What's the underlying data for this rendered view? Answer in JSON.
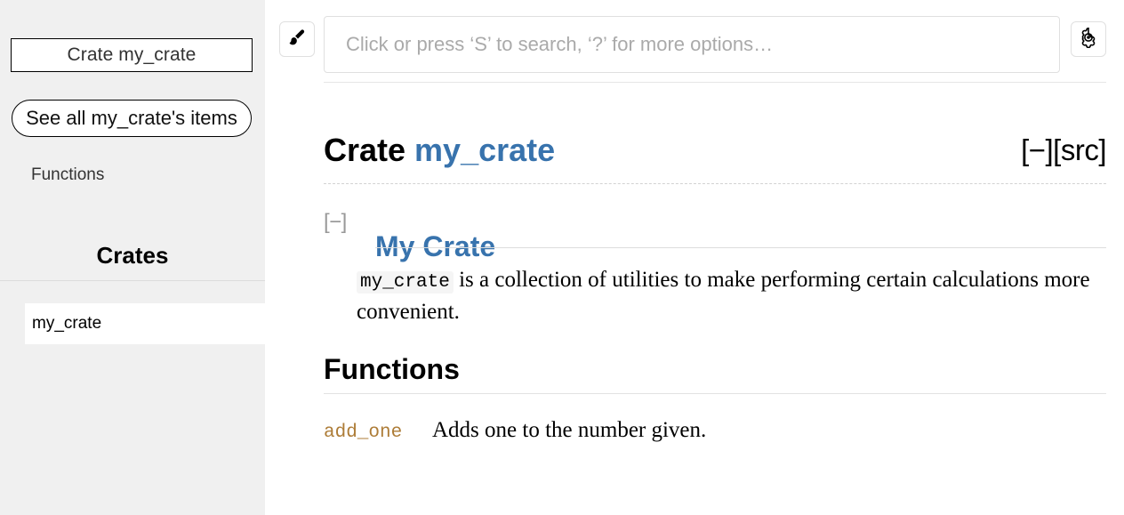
{
  "sidebar": {
    "crate_box_label": "Crate my_crate",
    "all_items_label": "See all my_crate's items",
    "section_link": "Functions",
    "crates_heading": "Crates",
    "crates": [
      {
        "name": "my_crate"
      }
    ]
  },
  "topbar": {
    "theme_icon": "paintbrush-icon",
    "settings_icon": "gear-icon",
    "search": {
      "value": "",
      "placeholder": "Click or press ‘S’ to search, ‘?’ for more options…"
    }
  },
  "main": {
    "crate_title_prefix": "Crate ",
    "crate_title_name": "my_crate",
    "collapse_all_label": "[−]",
    "src_label": "[src]",
    "section": {
      "collapse_label": "[−]",
      "title": "My Crate",
      "doc_code": "my_crate",
      "doc_text": " is a collection of utilities to make performing certain calculations more convenient."
    },
    "functions_heading": "Functions",
    "functions": [
      {
        "name": "add_one",
        "description": "Adds one to the number given."
      }
    ]
  },
  "colors": {
    "link": "#3873ad",
    "fn_link": "#ad7c37",
    "sidebar_bg": "#f0f0f0",
    "page_bg": "#ffffff"
  }
}
